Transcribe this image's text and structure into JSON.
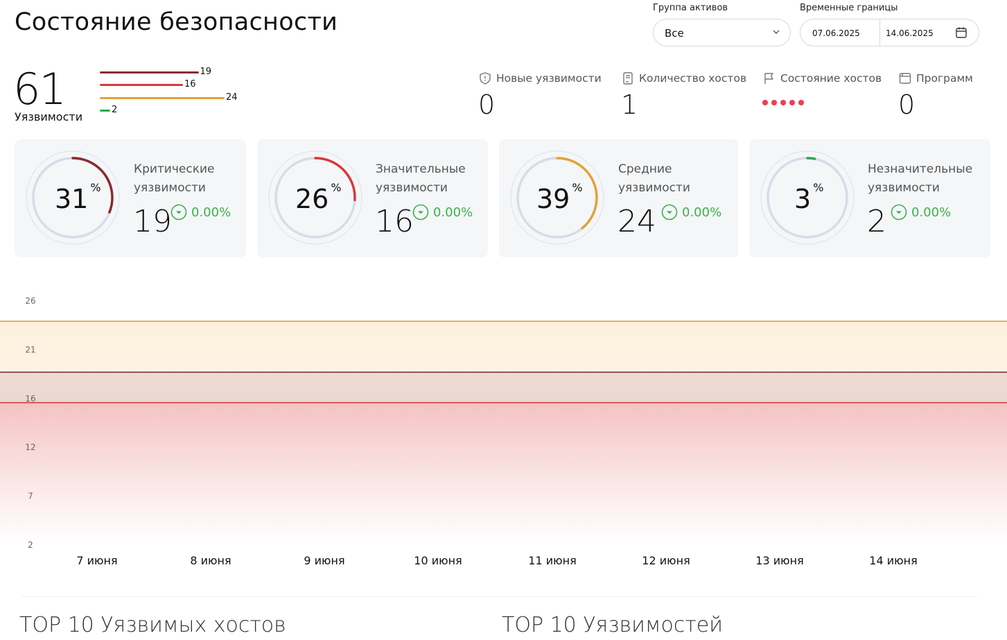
{
  "header": {
    "title": "Состояние безопасности",
    "asset_group_label": "Группа активов",
    "asset_group_value": "Все",
    "time_bounds_label": "Временные границы",
    "date_from": "07.06.2025",
    "date_to": "14.06.2025"
  },
  "summary": {
    "total": "61",
    "total_label": "Уязвимости",
    "bars": [
      {
        "label": "19",
        "value": 19,
        "color": "#8b2a2f"
      },
      {
        "label": "16",
        "value": 16,
        "color": "#d9383c"
      },
      {
        "label": "24",
        "value": 24,
        "color": "#e2a238"
      },
      {
        "label": "2",
        "value": 2,
        "color": "#2fa84f"
      }
    ]
  },
  "stats": {
    "new_vulns": {
      "label": "Новые уязвимости",
      "value": "0",
      "icon": "shield-icon"
    },
    "hosts_count": {
      "label": "Количество хостов",
      "value": "1",
      "icon": "document-icon"
    },
    "hosts_state": {
      "label": "Состояние хостов",
      "icon": "flag-icon",
      "dot_color": "#ef3d4c",
      "dots": 5
    },
    "programs": {
      "label": "Программ",
      "value": "0",
      "icon": "window-icon"
    }
  },
  "cards": [
    {
      "title1": "Критические",
      "title2": "уязвимости",
      "pct": "31",
      "pct_sign": "%",
      "count": "19",
      "delta": "0.00%",
      "fraction": 0.31,
      "color": "#8b2a2f"
    },
    {
      "title1": "Значительные",
      "title2": "уязвимости",
      "pct": "26",
      "pct_sign": "%",
      "count": "16",
      "delta": "0.00%",
      "fraction": 0.26,
      "color": "#d9383c"
    },
    {
      "title1": "Средние",
      "title2": "уязвимости",
      "pct": "39",
      "pct_sign": "%",
      "count": "24",
      "delta": "0.00%",
      "fraction": 0.39,
      "color": "#e2a238"
    },
    {
      "title1": "Незначительные",
      "title2": "уязвимости",
      "pct": "3",
      "pct_sign": "%",
      "count": "2",
      "delta": "0.00%",
      "fraction": 0.03,
      "color": "#2fa84f"
    }
  ],
  "chart_data": {
    "type": "area",
    "x": [
      "7 июня",
      "8 июня",
      "9 июня",
      "10 июня",
      "11 июня",
      "12 июня",
      "13 июня",
      "14 июня"
    ],
    "y_ticks": [
      "26",
      "21",
      "16",
      "12",
      "7",
      "2"
    ],
    "ylim": [
      2,
      26
    ],
    "series": [
      {
        "values": [
          24,
          24,
          24,
          24,
          24,
          24,
          24,
          24
        ],
        "color": "#e2a238"
      },
      {
        "values": [
          19,
          19,
          19,
          19,
          19,
          19,
          19,
          19
        ],
        "color": "#8b2a2f"
      },
      {
        "values": [
          16,
          16,
          16,
          16,
          16,
          16,
          16,
          16
        ],
        "color": "#d9383c"
      }
    ],
    "grid": false
  },
  "sections": {
    "top_hosts": "TOP 10 Уязвимых хостов",
    "top_vulns": "TOP 10 Уязвимостей"
  }
}
